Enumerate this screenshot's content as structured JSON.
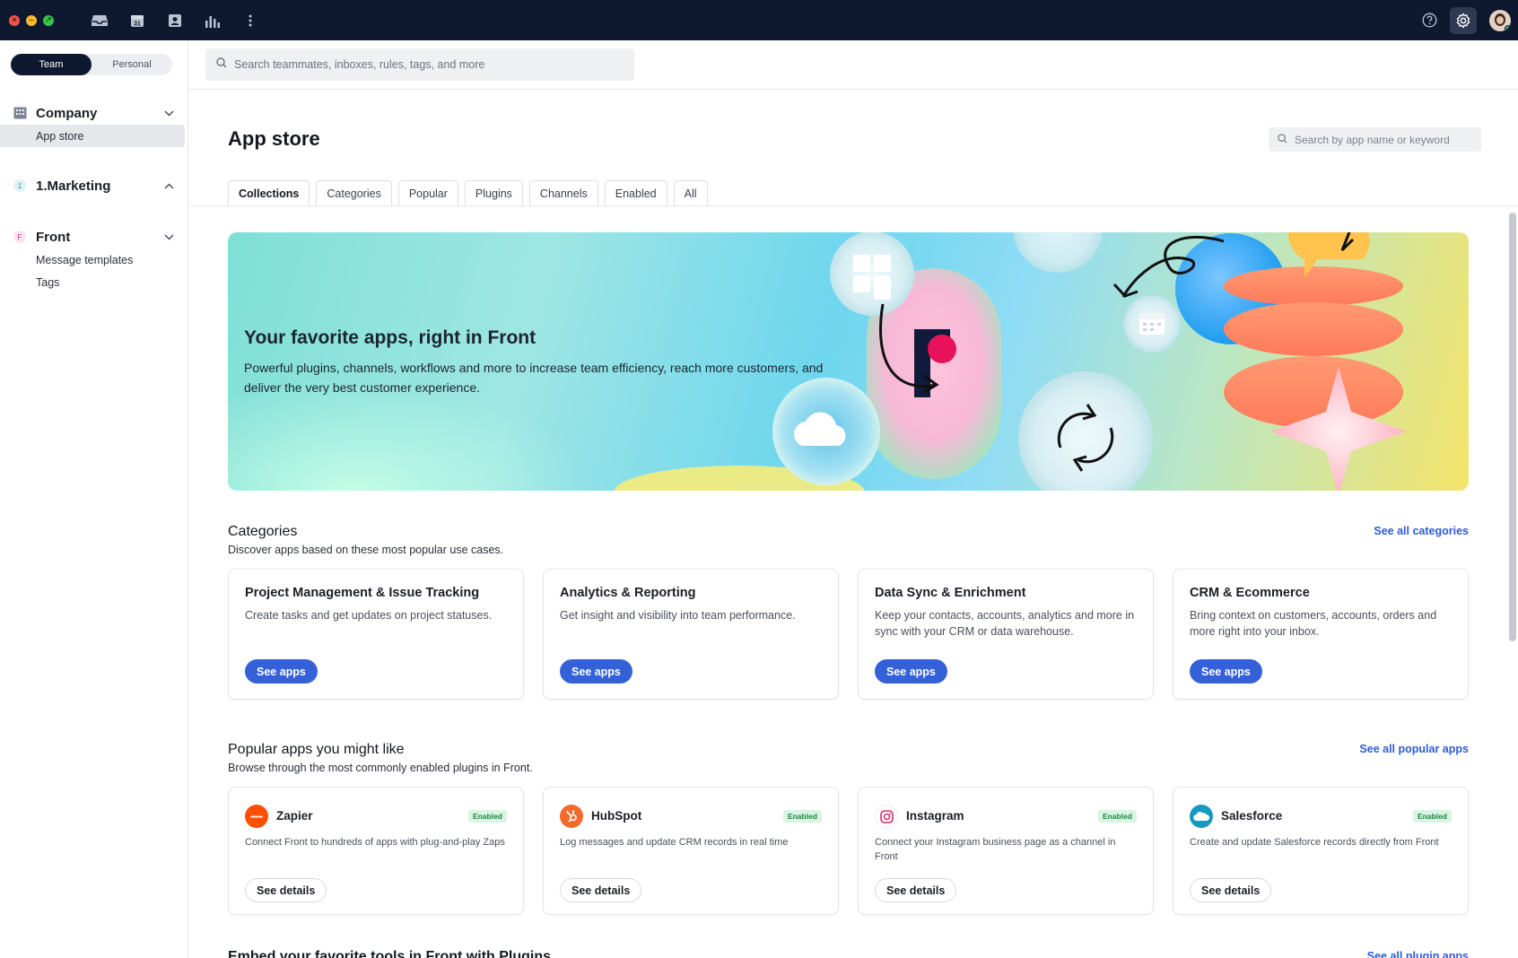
{
  "topbar": {
    "icons": [
      "inbox-icon",
      "calendar-icon",
      "contacts-icon",
      "analytics-icon",
      "more-icon"
    ],
    "calendar_day": "31",
    "right_icons": [
      "help-icon",
      "settings-icon",
      "avatar"
    ]
  },
  "sidebar": {
    "toggle": {
      "team": "Team",
      "personal": "Personal"
    },
    "groups": [
      {
        "title": "Company",
        "items": [
          "App store"
        ],
        "selected": "App store",
        "expanded": true
      },
      {
        "title": "1.Marketing",
        "badge": "1",
        "items": [],
        "expanded": true
      },
      {
        "title": "Front",
        "badge": "F",
        "items": [
          "Message templates",
          "Tags"
        ],
        "expanded": false
      }
    ]
  },
  "search": {
    "placeholder": "Search teammates, inboxes, rules, tags, and more"
  },
  "page": {
    "title": "App store",
    "app_search_placeholder": "Search by app name or keyword",
    "tabs": [
      "Collections",
      "Categories",
      "Popular",
      "Plugins",
      "Channels",
      "Enabled",
      "All"
    ],
    "active_tab": "Collections"
  },
  "hero": {
    "title": "Your favorite apps, right in Front",
    "subtitle": "Powerful plugins, channels, workflows and more to increase team efficiency, reach more customers, and deliver the very best customer experience."
  },
  "categories": {
    "title": "Categories",
    "subtitle": "Discover apps based on these most popular use cases.",
    "link": "See all categories",
    "button_label": "See apps",
    "cards": [
      {
        "title": "Project Management & Issue Tracking",
        "desc": "Create tasks and get updates on project statuses."
      },
      {
        "title": "Analytics & Reporting",
        "desc": "Get insight and visibility into team performance."
      },
      {
        "title": "Data Sync & Enrichment",
        "desc": "Keep your contacts, accounts, analytics and more in sync with your CRM or data warehouse."
      },
      {
        "title": "CRM & Ecommerce",
        "desc": "Bring context on customers, accounts, orders and more right into your inbox."
      }
    ]
  },
  "popular": {
    "title": "Popular apps you might like",
    "subtitle": "Browse through the most commonly enabled plugins in Front.",
    "link": "See all popular apps",
    "button_label": "See details",
    "apps": [
      {
        "name": "Zapier",
        "status": "Enabled",
        "desc": "Connect Front to hundreds of apps with plug-and-play Zaps",
        "color": "#ff4f00"
      },
      {
        "name": "HubSpot",
        "status": "Enabled",
        "desc": "Log messages and update CRM records in real time",
        "color": "#f26a2e"
      },
      {
        "name": "Instagram",
        "status": "Enabled",
        "desc": "Connect your Instagram business page as a channel in Front",
        "color": "#d62976"
      },
      {
        "name": "Salesforce",
        "status": "Enabled",
        "desc": "Create and update Salesforce records directly from Front",
        "color": "#1798c1"
      }
    ]
  },
  "plugins_section": {
    "title": "Embed your favorite tools in Front with Plugins",
    "link": "See all plugin apps"
  }
}
